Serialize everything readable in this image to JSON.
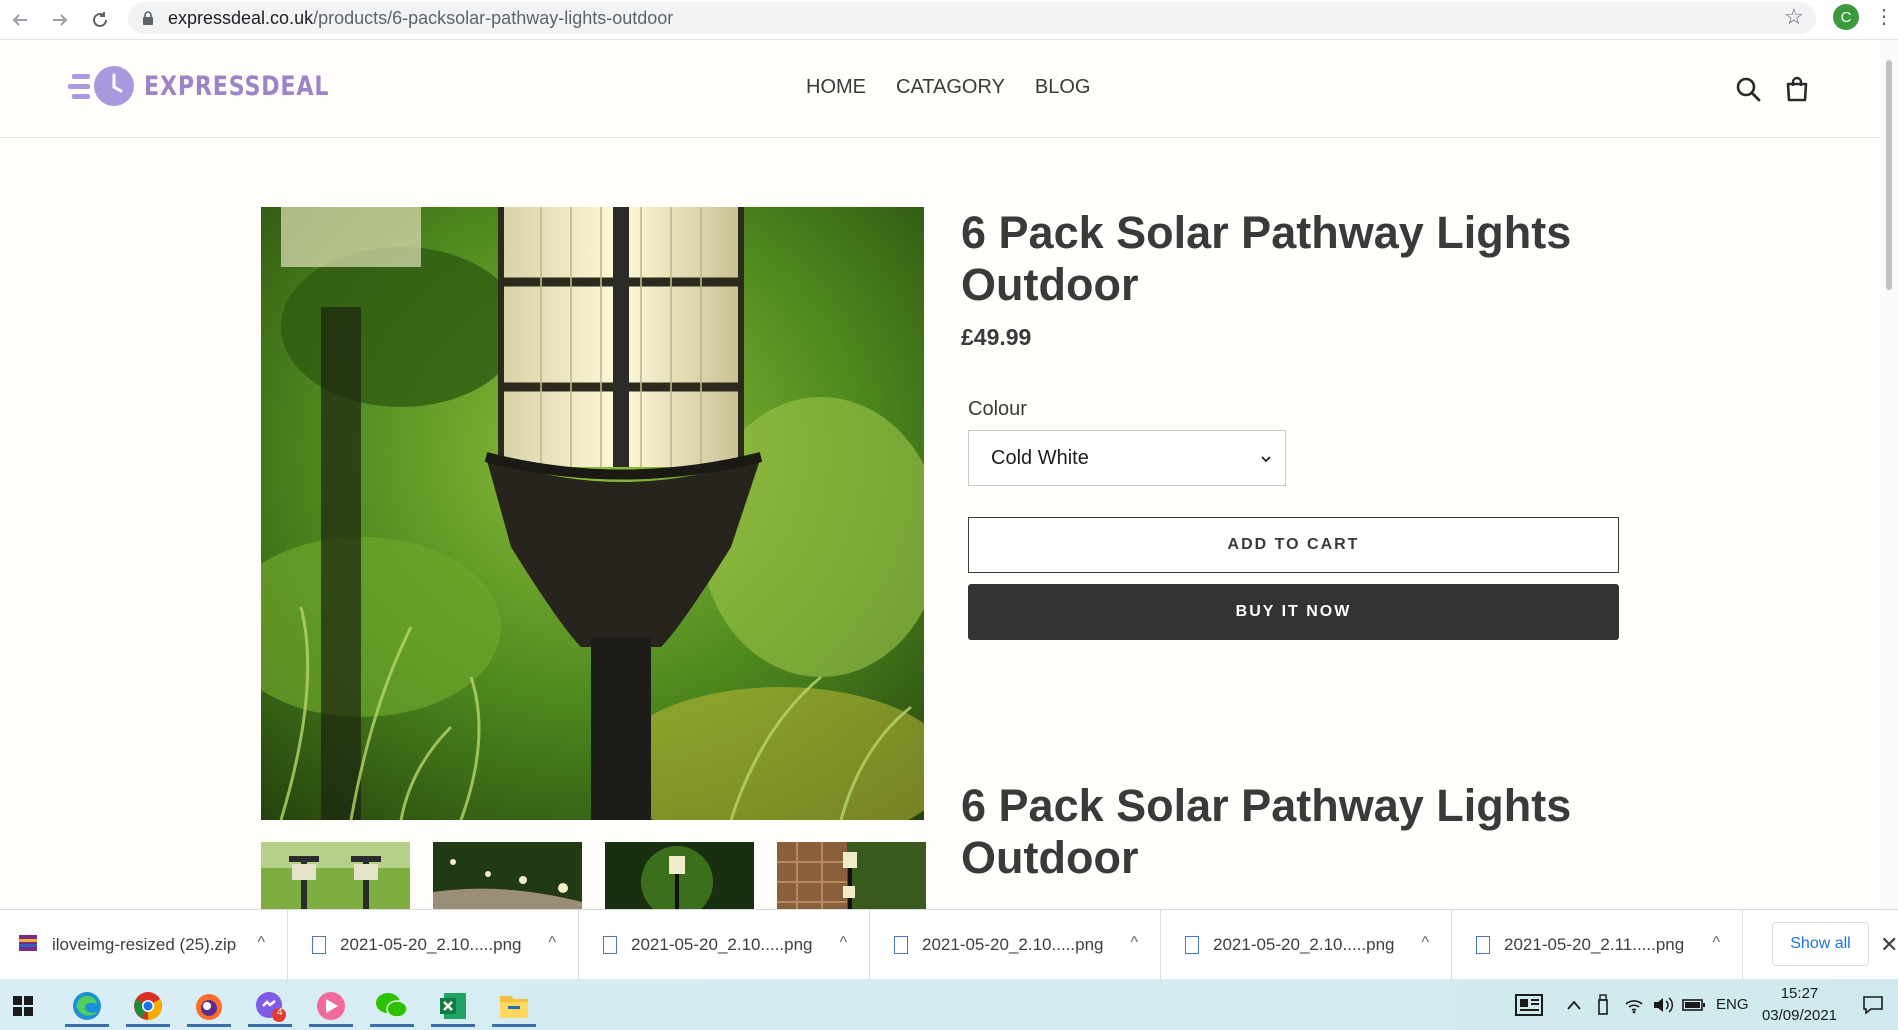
{
  "browser": {
    "url_host": "expressdeal.co.uk",
    "url_path": "/products/6-packsolar-pathway-lights-outdoor",
    "profile_initial": "C"
  },
  "site": {
    "brand": "EXPRESSDEAL",
    "nav": [
      "HOME",
      "CATAGORY",
      "BLOG"
    ],
    "brand_color": "#9c84c7"
  },
  "product": {
    "title": "6 Pack Solar Pathway Lights Outdoor",
    "price": "£49.99",
    "option_label": "Colour",
    "option_value": "Cold White",
    "add_to_cart": "ADD TO CART",
    "buy_now": "BUY IT NOW",
    "description_title": "6 Pack Solar Pathway Lights Outdoor"
  },
  "downloads": {
    "items": [
      "iloveimg-resized (25).zip",
      "2021-05-20_2.10.....png",
      "2021-05-20_2.10.....png",
      "2021-05-20_2.10.....png",
      "2021-05-20_2.10.....png",
      "2021-05-20_2.11.....png"
    ],
    "show_all": "Show all"
  },
  "taskbar": {
    "language": "ENG",
    "time": "15:27",
    "date": "03/09/2021",
    "badge": "4"
  }
}
